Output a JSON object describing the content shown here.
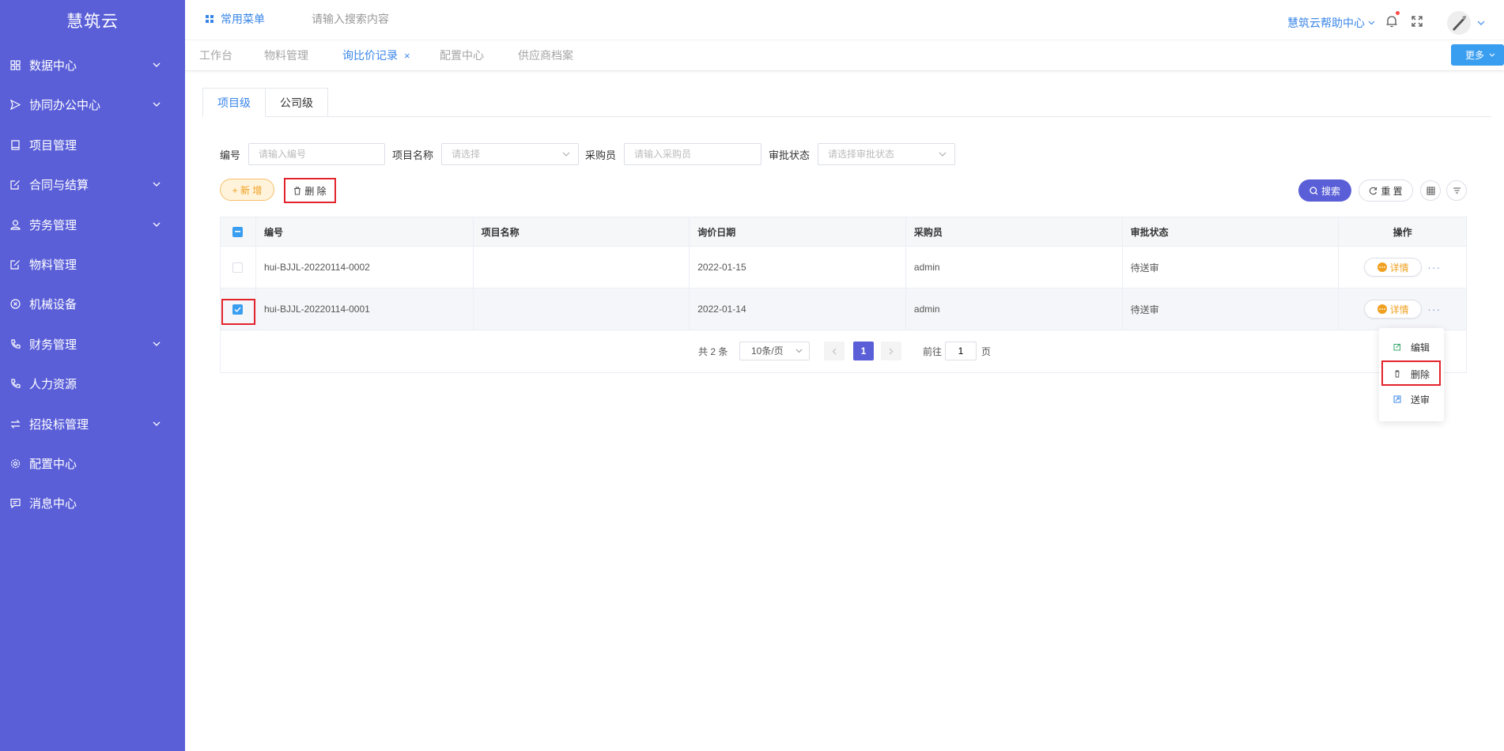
{
  "app": {
    "title": "慧筑云"
  },
  "sidebar": {
    "items": [
      {
        "label": "数据中心",
        "icon": "grid-icon",
        "expandable": true
      },
      {
        "label": "协同办公中心",
        "icon": "send-icon",
        "expandable": true
      },
      {
        "label": "项目管理",
        "icon": "book-icon",
        "expandable": false
      },
      {
        "label": "合同与结算",
        "icon": "edit-doc-icon",
        "expandable": true
      },
      {
        "label": "劳务管理",
        "icon": "user-icon",
        "expandable": true
      },
      {
        "label": "物料管理",
        "icon": "edit-doc-icon",
        "expandable": false
      },
      {
        "label": "机械设备",
        "icon": "close-circle-icon",
        "expandable": false
      },
      {
        "label": "财务管理",
        "icon": "phone-icon",
        "expandable": true
      },
      {
        "label": "人力资源",
        "icon": "phone-icon",
        "expandable": false
      },
      {
        "label": "招投标管理",
        "icon": "exchange-icon",
        "expandable": true
      },
      {
        "label": "配置中心",
        "icon": "settings-icon",
        "expandable": false
      },
      {
        "label": "消息中心",
        "icon": "message-icon",
        "expandable": false
      }
    ]
  },
  "header": {
    "quick_menu": "常用菜单",
    "search_placeholder": "请输入搜索内容",
    "help_center": "慧筑云帮助中心"
  },
  "tabs": {
    "items": [
      {
        "label": "工作台",
        "active": false
      },
      {
        "label": "物料管理",
        "active": false
      },
      {
        "label": "询比价记录",
        "active": true,
        "close": "×"
      },
      {
        "label": "配置中心",
        "active": false
      },
      {
        "label": "供应商档案",
        "active": false
      }
    ],
    "more_label": "更多"
  },
  "level_tabs": [
    {
      "label": "项目级",
      "active": true
    },
    {
      "label": "公司级",
      "active": false
    }
  ],
  "filters": {
    "code": {
      "label": "编号",
      "placeholder": "请输入编号"
    },
    "project": {
      "label": "项目名称",
      "placeholder": "请选择"
    },
    "buyer": {
      "label": "采购员",
      "placeholder": "请输入采购员"
    },
    "status": {
      "label": "审批状态",
      "placeholder": "请选择审批状态"
    }
  },
  "toolbar": {
    "add_label": "+ 新 增",
    "delete_label": "删 除",
    "search_label": "搜索",
    "reset_label": "重 置"
  },
  "table": {
    "columns": [
      "编号",
      "项目名称",
      "询价日期",
      "采购员",
      "审批状态",
      "操作"
    ],
    "rows": [
      {
        "code": "hui-BJJL-20220114-0002",
        "project": "",
        "date": "2022-01-15",
        "buyer": "admin",
        "status": "待送审",
        "checked": false
      },
      {
        "code": "hui-BJJL-20220114-0001",
        "project": "",
        "date": "2022-01-14",
        "buyer": "admin",
        "status": "待送审",
        "checked": true
      }
    ],
    "detail_label": "详情",
    "more_ellipsis": "···"
  },
  "pagination": {
    "total_text": "共 2 条",
    "page_size": "10条/页",
    "current_page": "1",
    "goto_label": "前往",
    "goto_value": "1",
    "page_suffix": "页"
  },
  "row_menu": {
    "items": [
      {
        "label": "编辑",
        "icon": "edit-icon"
      },
      {
        "label": "删除",
        "icon": "trash-icon"
      },
      {
        "label": "送审",
        "icon": "submit-icon"
      }
    ]
  },
  "colors": {
    "sidebar_bg": "#5a5fd8",
    "accent_blue": "#3a86e8",
    "primary_purple": "#5a5fd8",
    "warning_orange": "#f0a020",
    "highlight_red": "#e3232b"
  }
}
